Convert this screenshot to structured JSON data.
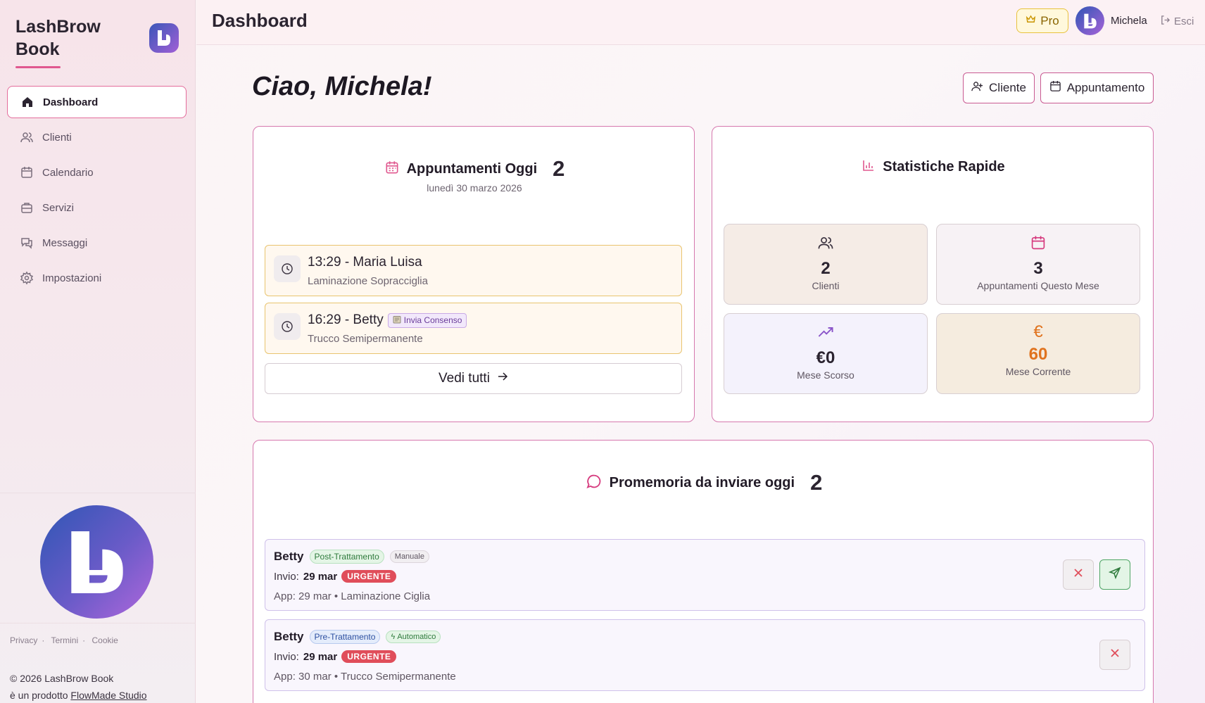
{
  "app": {
    "brand_line1": "LashBrow",
    "brand_line2": "Book"
  },
  "sidebar": {
    "items": [
      {
        "label": "Dashboard",
        "icon": "home-icon",
        "active": true
      },
      {
        "label": "Clienti",
        "icon": "users-icon"
      },
      {
        "label": "Calendario",
        "icon": "calendar-icon"
      },
      {
        "label": "Servizi",
        "icon": "briefcase-icon"
      },
      {
        "label": "Messaggi",
        "icon": "messages-icon"
      },
      {
        "label": "Impostazioni",
        "icon": "gear-icon"
      }
    ],
    "legal": [
      "Privacy",
      "Termini",
      "Cookie"
    ],
    "copyright": "© 2026 LashBrow Book",
    "product_prefix": "è un prodotto",
    "product_link": "FlowMade Studio"
  },
  "topbar": {
    "title": "Dashboard",
    "plan": "Pro",
    "user": "Michela",
    "logout": "Esci"
  },
  "main": {
    "greeting": "Ciao, Michela!",
    "btn_client": "Cliente",
    "btn_appointment": "Appuntamento"
  },
  "today": {
    "title": "Appuntamenti Oggi",
    "count": "2",
    "date": "lunedì 30 marzo 2026",
    "appointments": [
      {
        "time_name": "13:29 - Maria Luisa",
        "service": "Laminazione Sopracciglia",
        "badge": ""
      },
      {
        "time_name": "16:29 - Betty",
        "service": "Trucco Semipermanente",
        "badge": "Invia Consenso"
      }
    ],
    "see_all": "Vedi tutti"
  },
  "stats": {
    "title": "Statistiche Rapide",
    "items": [
      {
        "value": "2",
        "label": "Clienti",
        "icon": "users-icon",
        "bg": "#f5ece6"
      },
      {
        "value": "3",
        "label": "Appuntamenti Questo Mese",
        "icon": "calendar-icon",
        "bg": "#f7f2f5"
      },
      {
        "value": "€0",
        "label": "Mese Scorso",
        "icon": "trending-up-icon",
        "bg": "#f4f2fc"
      },
      {
        "value": "60",
        "label": "Mese Corrente",
        "icon": "euro-icon",
        "bg": "#f5ecdf",
        "accent": "#e0731e"
      }
    ]
  },
  "reminders": {
    "title": "Promemoria da inviare oggi",
    "count": "2",
    "items": [
      {
        "name": "Betty",
        "type": "Post-Trattamento",
        "mode": "Manuale",
        "send_label": "Invio:",
        "send_date": "29 mar",
        "urgent": "URGENTE",
        "app": "App: 29 mar • Laminazione Ciglia"
      },
      {
        "name": "Betty",
        "type": "Pre-Trattamento",
        "mode": "Automatico",
        "send_label": "Invio:",
        "send_date": "29 mar",
        "urgent": "URGENTE",
        "app": "App: 30 mar • Trucco Semipermanente"
      }
    ]
  },
  "colors": {
    "accent": "#e0588f",
    "card_border": "#d678ae",
    "urgent": "#e04d5a"
  }
}
